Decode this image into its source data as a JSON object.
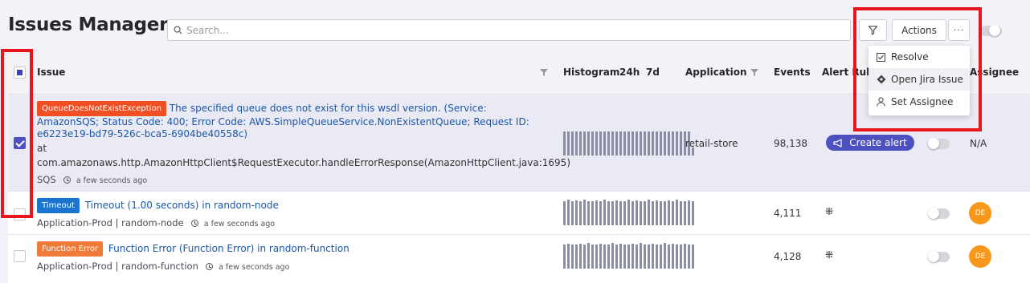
{
  "header": {
    "title": "Issues Manager",
    "search_placeholder": "Search...",
    "actions_label": "Actions",
    "more_label": "···"
  },
  "actions_menu": {
    "items": [
      {
        "label": "Resolve",
        "icon": "check-square-icon"
      },
      {
        "label": "Open Jira Issue",
        "icon": "jira-diamond-icon"
      },
      {
        "label": "Set Assignee",
        "icon": "person-icon"
      }
    ]
  },
  "table": {
    "columns": {
      "issue": "Issue",
      "histogram": "Histogram",
      "range_24h": "24h",
      "range_7d": "7d",
      "application": "Application",
      "events": "Events",
      "alert_rules": "Alert Rule",
      "assignee": "Assignee"
    },
    "rows": [
      {
        "selected": true,
        "tag": "QueueDoesNotExistException",
        "tag_color": "#f04e23",
        "title": "The specified queue does not exist for this wsdl version. (Service: AmazonSQS; Status Code: 400; Error Code: AWS.SimpleQueueService.NonExistentQueue; Request ID: e6223e19-bd79-526c-bca5-6904be40558c)",
        "detail_1": "at",
        "detail_2": "com.amazonaws.http.AmazonHttpClient$RequestExecutor.handleErrorResponse(AmazonHttpClient.java:1695)",
        "source": "SQS",
        "time": "a few seconds ago",
        "application": "retail-store",
        "events": "98,138",
        "alert_button": "Create alert",
        "assignee": "N/A"
      },
      {
        "selected": false,
        "tag": "Timeout",
        "tag_color": "#1b75d0",
        "title": "Timeout (1.00 seconds) in random-node",
        "meta": "Application-Prod | random-node",
        "time": "a few seconds ago",
        "application": "",
        "events": "4,111",
        "assignee": "DE"
      },
      {
        "selected": false,
        "tag": "Function Error",
        "tag_color": "#f07a3a",
        "title": "Function Error (Function Error) in random-function",
        "meta": "Application-Prod | random-function",
        "time": "a few seconds ago",
        "application": "",
        "events": "4,128",
        "assignee": "DE"
      }
    ]
  },
  "colors": {
    "accent": "#4c51bf",
    "highlight_box": "#e8161c",
    "avatar": "#f7981d",
    "histogram_bar": "#8b8ea3"
  }
}
